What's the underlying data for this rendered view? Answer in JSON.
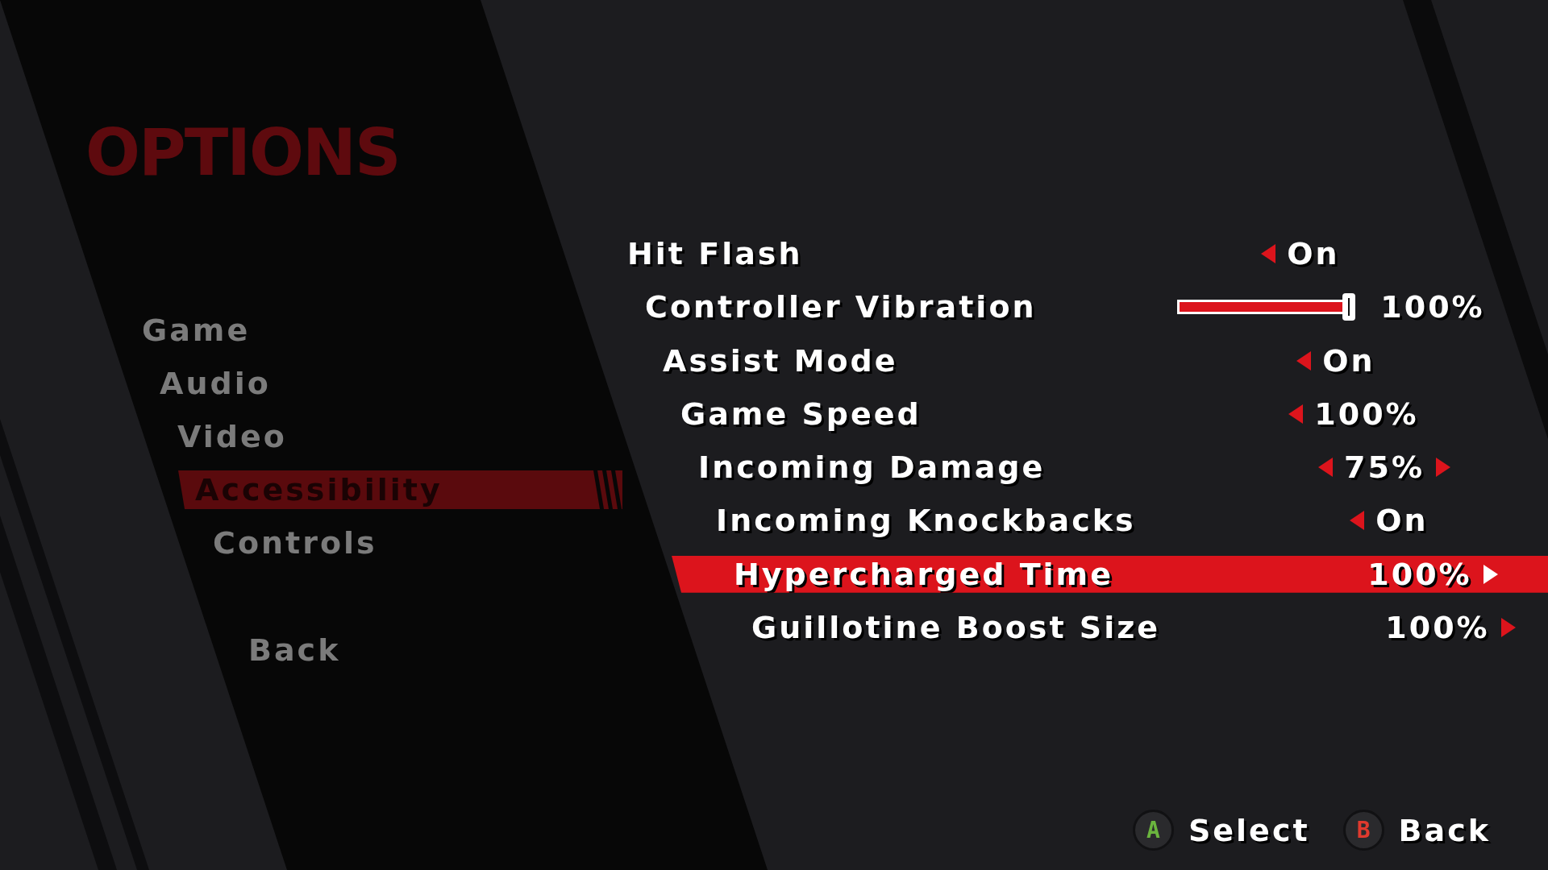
{
  "title": "OPTIONS",
  "menu": [
    {
      "label": "Game",
      "selected": false
    },
    {
      "label": "Audio",
      "selected": false
    },
    {
      "label": "Video",
      "selected": false
    },
    {
      "label": "Accessibility",
      "selected": true
    },
    {
      "label": "Controls",
      "selected": false
    }
  ],
  "back_item": {
    "label": "Back"
  },
  "settings": [
    {
      "label": "Hit Flash",
      "kind": "choice",
      "value": "On",
      "can_decrease": true,
      "can_increase": false,
      "selected": false
    },
    {
      "label": "Controller Vibration",
      "kind": "slider",
      "level": 1.0,
      "reading": "100%",
      "selected": false
    },
    {
      "label": "Assist Mode",
      "kind": "choice",
      "value": "On",
      "can_decrease": true,
      "can_increase": false,
      "selected": false
    },
    {
      "label": "Game Speed",
      "kind": "choice",
      "value": "100%",
      "can_decrease": true,
      "can_increase": false,
      "selected": false
    },
    {
      "label": "Incoming Damage",
      "kind": "choice",
      "value": "75%",
      "can_decrease": true,
      "can_increase": true,
      "selected": false
    },
    {
      "label": "Incoming Knockbacks",
      "kind": "choice",
      "value": "On",
      "can_decrease": true,
      "can_increase": false,
      "selected": false
    },
    {
      "label": "Hypercharged Time",
      "kind": "choice",
      "value": "100%",
      "can_decrease": false,
      "can_increase": true,
      "selected": true
    },
    {
      "label": "Guillotine Boost Size",
      "kind": "choice",
      "value": "100%",
      "can_decrease": false,
      "can_increase": true,
      "selected": false
    }
  ],
  "hints": [
    {
      "key": "A",
      "label": "Select",
      "color": "#6ab43e"
    },
    {
      "key": "B",
      "label": "Back",
      "color": "#e03a2e"
    }
  ]
}
